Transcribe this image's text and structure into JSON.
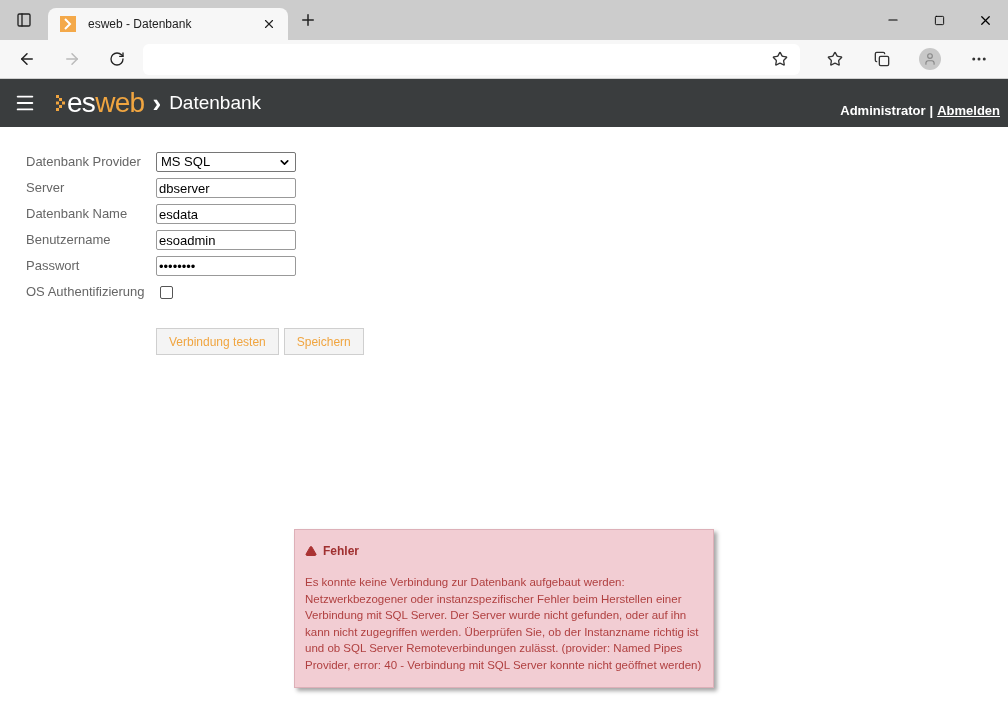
{
  "browser": {
    "tab": {
      "title": "esweb - Datenbank",
      "selected": true
    }
  },
  "header": {
    "logo_first": "es",
    "logo_second": "web",
    "separator": "›",
    "page_title": "Datenbank",
    "user": "Administrator",
    "divider": "|",
    "logout": "Abmelden"
  },
  "form": {
    "fields": [
      {
        "kind": "select",
        "label": "Datenbank Provider",
        "value": "MS SQL"
      },
      {
        "kind": "text",
        "label": "Server",
        "value": "dbserver"
      },
      {
        "kind": "text",
        "label": "Datenbank Name",
        "value": "esdata"
      },
      {
        "kind": "text",
        "label": "Benutzername",
        "value": "esoadmin"
      },
      {
        "kind": "password",
        "label": "Passwort",
        "value": "••••••••"
      },
      {
        "kind": "checkbox",
        "label": "OS Authentifizierung",
        "checked": false
      }
    ],
    "buttons": [
      "Verbindung testen",
      "Speichern"
    ]
  },
  "error": {
    "title": "Fehler",
    "message": "Es konnte keine Verbindung zur Datenbank aufgebaut werden: Netzwerkbezogener oder instanzspezifischer Fehler beim Herstellen einer Verbindung mit SQL Server. Der Server wurde nicht gefunden, oder auf ihn kann nicht zugegriffen werden. Überprüfen Sie, ob der Instanzname richtig ist und ob SQL Server Remoteverbindungen zulässt. (provider: Named Pipes Provider, error: 40 - Verbindung mit SQL Server konnte nicht geöffnet werden)"
  }
}
